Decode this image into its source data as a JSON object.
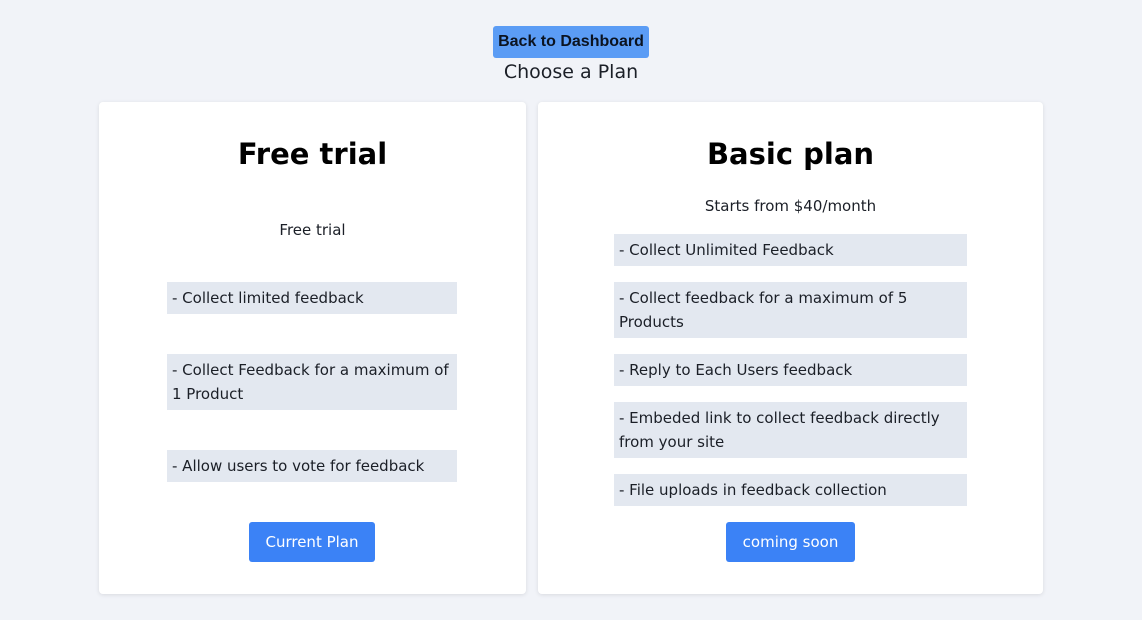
{
  "header": {
    "back_button_label": "Back to Dashboard",
    "title": "Choose a Plan"
  },
  "plans": [
    {
      "name": "Free trial",
      "subtitle": "Free trial",
      "features": [
        "- Collect limited feedback",
        "- Collect Feedback for a maximum of 1 Product",
        "- Allow users to vote for feedback"
      ],
      "button_label": "Current Plan"
    },
    {
      "name": "Basic plan",
      "subtitle": "Starts from $40/month",
      "features": [
        "- Collect Unlimited Feedback",
        "- Collect feedback for a maximum of 5 Products",
        "- Reply to Each Users feedback",
        "- Embeded link to collect feedback directly from your site",
        "- File uploads in feedback collection"
      ],
      "button_label": "coming soon"
    }
  ],
  "colors": {
    "page_background": "#f1f3f8",
    "back_button": "#5b9cf5",
    "primary_button": "#3b82f6",
    "feature_background": "#e3e8f0"
  }
}
